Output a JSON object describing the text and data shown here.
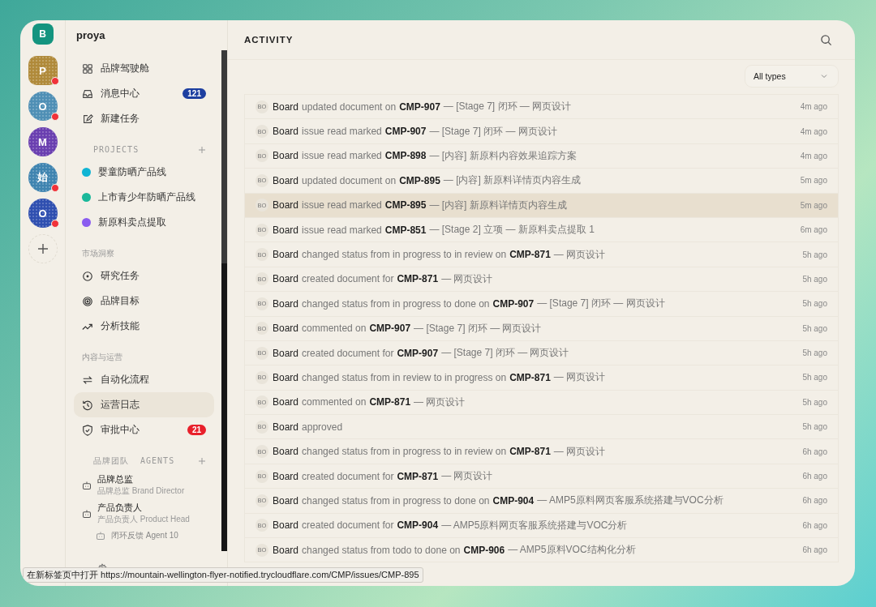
{
  "rail": {
    "top": "B",
    "workspaces": [
      {
        "initial": "P",
        "color": "#b08a3a",
        "notification": true
      },
      {
        "initial": "O",
        "color": "#4f8fb5",
        "notification": true
      },
      {
        "initial": "M",
        "color": "#6a3fb0",
        "notification": false
      },
      {
        "initial": "始",
        "color": "#3f84b0",
        "notification": true
      },
      {
        "initial": "O",
        "color": "#2f4fb0",
        "notification": true
      }
    ]
  },
  "sidebar": {
    "workspace": "proya",
    "main_items": [
      {
        "label": "品牌驾驶舱",
        "selected": false
      },
      {
        "label": "消息中心",
        "badge": {
          "text": "121",
          "color": "#1d3fa0"
        },
        "selected": false
      },
      {
        "label": "新建任务",
        "selected": false
      }
    ],
    "projects": {
      "title": "PROJECTS",
      "items": [
        {
          "label": "婴童防晒产品线",
          "color": "#10b4d4"
        },
        {
          "label": "上市青少年防晒产品线",
          "color": "#1ab89a"
        },
        {
          "label": "新原料卖点提取",
          "color": "#8a5cf0"
        }
      ]
    },
    "sections": [
      {
        "title": "市场洞察",
        "items": [
          {
            "label": "研究任务",
            "selected": false
          },
          {
            "label": "品牌目标",
            "selected": false
          },
          {
            "label": "分析技能",
            "selected": false
          }
        ]
      },
      {
        "title": "内容与运营",
        "items": [
          {
            "label": "自动化流程",
            "selected": false
          },
          {
            "label": "运营日志",
            "selected": true
          },
          {
            "label": "审批中心",
            "badge": {
              "text": "21",
              "color": "#e8202b"
            },
            "selected": false
          }
        ]
      }
    ],
    "agents": {
      "title": "品牌团队  AGENTS",
      "items": [
        {
          "name": "品牌总监",
          "role": "品牌总监 Brand Director"
        },
        {
          "name": "产品负责人",
          "role": "产品负责人 Product Head",
          "children": [
            {
              "name": "闭环反馈 Agent 10"
            }
          ]
        }
      ]
    }
  },
  "main": {
    "title": "ACTIVITY",
    "filter": "All types",
    "rows": [
      {
        "avatar": "BO",
        "actor": "Board",
        "action": "updated document on",
        "issue": "CMP-907",
        "suffix": "— [Stage 7] 闭环 — 网页设计",
        "time": "4m ago",
        "hovered": false
      },
      {
        "avatar": "BO",
        "actor": "Board",
        "action": "issue read marked",
        "issue": "CMP-907",
        "suffix": "— [Stage 7] 闭环 — 网页设计",
        "time": "4m ago",
        "hovered": false
      },
      {
        "avatar": "BO",
        "actor": "Board",
        "action": "issue read marked",
        "issue": "CMP-898",
        "suffix": "— [内容] 新原料内容效果追踪方案",
        "time": "4m ago",
        "hovered": false
      },
      {
        "avatar": "BO",
        "actor": "Board",
        "action": "updated document on",
        "issue": "CMP-895",
        "suffix": "— [内容] 新原料详情页内容生成",
        "time": "5m ago",
        "hovered": false
      },
      {
        "avatar": "BO",
        "actor": "Board",
        "action": "issue read marked",
        "issue": "CMP-895",
        "suffix": "— [内容] 新原料详情页内容生成",
        "time": "5m ago",
        "hovered": true
      },
      {
        "avatar": "BO",
        "actor": "Board",
        "action": "issue read marked",
        "issue": "CMP-851",
        "suffix": "— [Stage 2] 立项 — 新原料卖点提取 1",
        "time": "6m ago",
        "hovered": false
      },
      {
        "avatar": "BO",
        "actor": "Board",
        "action": "changed status from in progress to in review on",
        "issue": "CMP-871",
        "suffix": "— 网页设计",
        "time": "5h ago",
        "hovered": false
      },
      {
        "avatar": "BO",
        "actor": "Board",
        "action": "created document for",
        "issue": "CMP-871",
        "suffix": "— 网页设计",
        "time": "5h ago",
        "hovered": false
      },
      {
        "avatar": "BO",
        "actor": "Board",
        "action": "changed status from in progress to done on",
        "issue": "CMP-907",
        "suffix": "— [Stage 7] 闭环 — 网页设计",
        "time": "5h ago",
        "hovered": false
      },
      {
        "avatar": "BO",
        "actor": "Board",
        "action": "commented on",
        "issue": "CMP-907",
        "suffix": "— [Stage 7] 闭环 — 网页设计",
        "time": "5h ago",
        "hovered": false
      },
      {
        "avatar": "BO",
        "actor": "Board",
        "action": "created document for",
        "issue": "CMP-907",
        "suffix": "— [Stage 7] 闭环 — 网页设计",
        "time": "5h ago",
        "hovered": false
      },
      {
        "avatar": "BO",
        "actor": "Board",
        "action": "changed status from in review to in progress on",
        "issue": "CMP-871",
        "suffix": "— 网页设计",
        "time": "5h ago",
        "hovered": false
      },
      {
        "avatar": "BO",
        "actor": "Board",
        "action": "commented on",
        "issue": "CMP-871",
        "suffix": "— 网页设计",
        "time": "5h ago",
        "hovered": false
      },
      {
        "avatar": "BO",
        "actor": "Board",
        "action": "approved",
        "time": "5h ago",
        "hovered": false
      },
      {
        "avatar": "BO",
        "actor": "Board",
        "action": "changed status from in progress to in review on",
        "issue": "CMP-871",
        "suffix": "— 网页设计",
        "time": "6h ago",
        "hovered": false
      },
      {
        "avatar": "BO",
        "actor": "Board",
        "action": "created document for",
        "issue": "CMP-871",
        "suffix": "— 网页设计",
        "time": "6h ago",
        "hovered": false
      },
      {
        "avatar": "BO",
        "actor": "Board",
        "action": "changed status from in progress to done on",
        "issue": "CMP-904",
        "suffix": "— AMP5原料网页客服系统搭建与VOC分析",
        "time": "6h ago",
        "hovered": false
      },
      {
        "avatar": "BO",
        "actor": "Board",
        "action": "created document for",
        "issue": "CMP-904",
        "suffix": "— AMP5原料网页客服系统搭建与VOC分析",
        "time": "6h ago",
        "hovered": false
      },
      {
        "avatar": "BO",
        "actor": "Board",
        "action": "changed status from todo to done on",
        "issue": "CMP-906",
        "suffix": "— AMP5原料VOC结构化分析",
        "time": "6h ago",
        "hovered": false
      }
    ]
  },
  "status_url": "在新标签页中打开 https://mountain-wellington-flyer-notified.trycloudflare.com/CMP/issues/CMP-895"
}
